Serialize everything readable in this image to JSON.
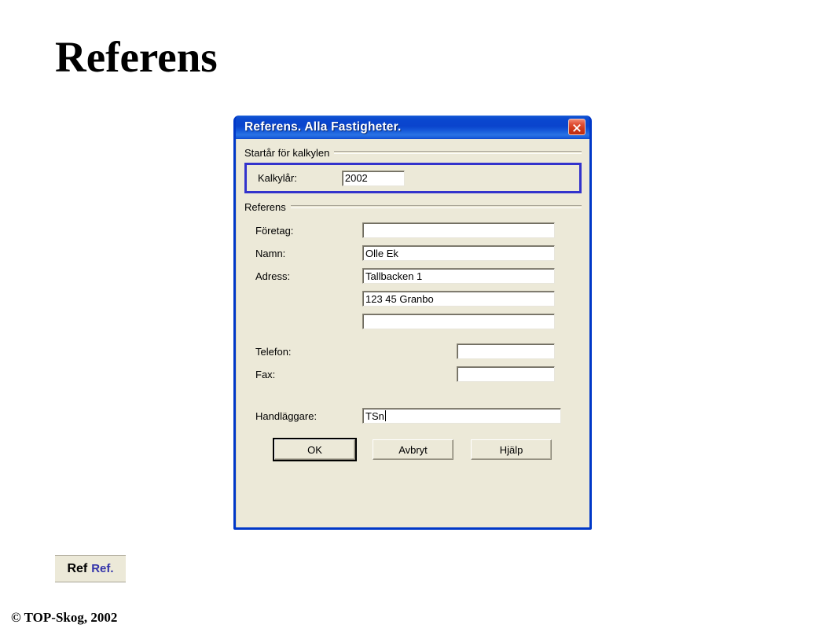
{
  "slide": {
    "title": "Referens",
    "footer": "© TOP-Skog, 2002",
    "background_color": "#ffffff"
  },
  "dialog": {
    "title": "Referens. Alla Fastigheter.",
    "close_icon": "close-icon",
    "titlebar_color": "#0a47cf",
    "body_color": "#ece9d8",
    "highlight_color": "#3333cc",
    "groups": [
      {
        "label": "Startår för kalkylen",
        "highlighted": true,
        "fields": [
          {
            "label": "Kalkylår:",
            "value": "2002",
            "placeholder": ""
          }
        ]
      },
      {
        "label": "Referens",
        "highlighted": false,
        "fields": [
          {
            "label": "Företag:",
            "value": "",
            "placeholder": ""
          },
          {
            "label": "Namn:",
            "value": "Olle Ek",
            "placeholder": ""
          },
          {
            "label": "Adress:",
            "value": "Tallbacken 1",
            "placeholder": ""
          },
          {
            "label": "",
            "value": "123 45 Granbo",
            "placeholder": ""
          },
          {
            "label": "",
            "value": "",
            "placeholder": ""
          },
          {
            "label": "Telefon:",
            "value": "",
            "placeholder": ""
          },
          {
            "label": "Fax:",
            "value": "",
            "placeholder": ""
          },
          {
            "label": "Handläggare:",
            "value": "TSn",
            "placeholder": ""
          }
        ]
      }
    ],
    "buttons": [
      {
        "label": "OK",
        "default": true
      },
      {
        "label": "Avbryt",
        "default": false
      },
      {
        "label": "Hjälp",
        "default": false
      }
    ]
  },
  "toolbar_button": {
    "icon_label": "Ref",
    "text_label": "Ref.",
    "text_color": "#3333aa"
  }
}
